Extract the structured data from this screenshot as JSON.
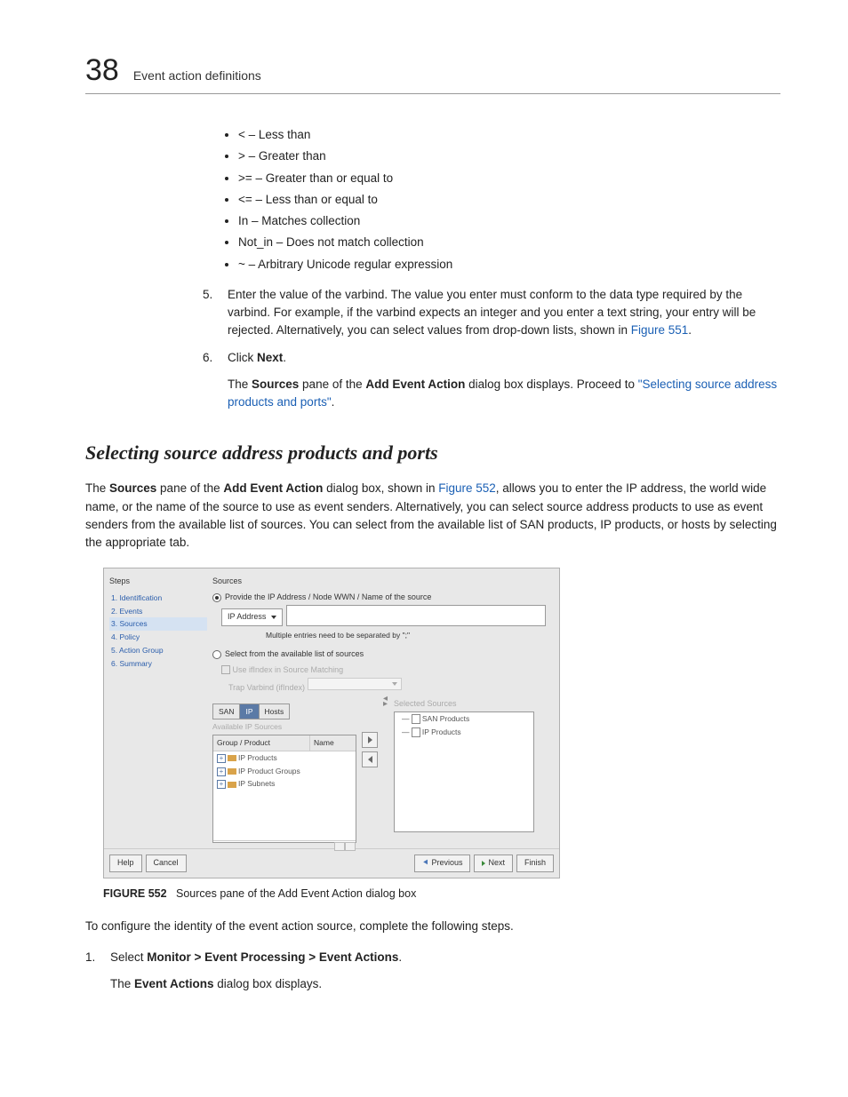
{
  "header": {
    "page_number": "38",
    "title": "Event action definitions"
  },
  "operators": [
    "< – Less than",
    "> – Greater than",
    ">= – Greater than or equal to",
    "<= – Less than or equal to",
    "In – Matches collection",
    "Not_in – Does not match collection",
    "~ – Arbitrary Unicode regular expression"
  ],
  "step5": {
    "num": "5.",
    "text_a": "Enter the value of the varbind. The value you enter must conform to the data type required by the varbind. For example, if the varbind expects an integer and you enter a text string, your entry will be rejected. Alternatively, you can select values from drop-down lists, shown in ",
    "link": "Figure 551",
    "text_b": "."
  },
  "step6": {
    "num": "6.",
    "click": "Click ",
    "next": "Next",
    "period": ".",
    "desc_a": "The ",
    "sources": "Sources",
    "desc_b": " pane of the ",
    "addEvent": "Add Event Action",
    "desc_c": " dialog box displays. Proceed to ",
    "link": "\"Selecting source address products and ports\"",
    "desc_d": "."
  },
  "section_heading": "Selecting source address products and ports",
  "intro": {
    "a": "The ",
    "b": "Sources",
    "c": " pane of the ",
    "d": "Add Event Action",
    "e": " dialog box, shown in ",
    "link": "Figure 552",
    "f": ", allows you to enter the IP address, the world wide name, or the name of the source to use as event senders. Alternatively, you can select source address products to use as event senders from the available list of sources. You can select from the available list of SAN products, IP products, or hosts by selecting the appropriate tab."
  },
  "dialog": {
    "steps_title": "Steps",
    "steps": [
      "1. Identification",
      "2. Events",
      "3. Sources",
      "4. Policy",
      "5. Action Group",
      "6. Summary"
    ],
    "sources_title": "Sources",
    "radio1": "Provide the IP Address / Node WWN / Name of the source",
    "ip_label": "IP Address",
    "hint": "Multiple entries need to be separated by \";\"",
    "radio2": "Select from the available list of sources",
    "use_ifindex": "Use ifIndex in Source Matching",
    "trap_label": "Trap Varbind (ifIndex)",
    "tabs": [
      "SAN",
      "IP",
      "Hosts"
    ],
    "avail_title": "Available IP Sources",
    "columns": [
      "Group / Product",
      "Name"
    ],
    "tree": [
      "IP Products",
      "IP Product Groups",
      "IP Subnets"
    ],
    "selected_title": "Selected Sources",
    "selected_items": [
      "SAN Products",
      "IP Products"
    ],
    "buttons": {
      "help": "Help",
      "cancel": "Cancel",
      "previous": "Previous",
      "next": "Next",
      "finish": "Finish"
    }
  },
  "figure": {
    "label": "FIGURE 552",
    "caption": "Sources pane of the Add Event Action dialog box"
  },
  "outro": "To configure the identity of the event action source, complete the following steps.",
  "step1": {
    "num": "1.",
    "a": "Select ",
    "b": "Monitor > Event Processing > Event Actions",
    "c": ".",
    "d": "The ",
    "e": "Event Actions",
    "f": " dialog box displays."
  }
}
